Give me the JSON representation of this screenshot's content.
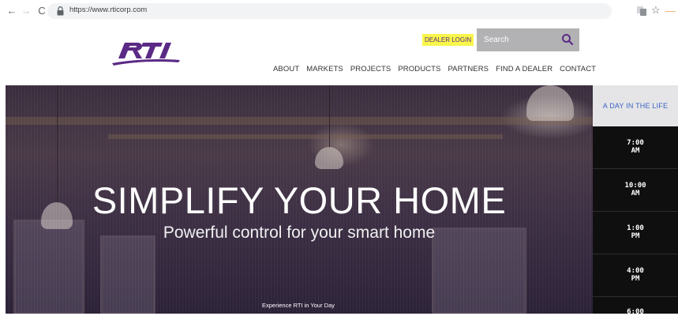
{
  "browser": {
    "url": "https://www.rticorp.com",
    "back_icon": "arrow-left",
    "forward_icon": "arrow-right",
    "reload_icon": "reload",
    "back_glyph": "←",
    "forward_glyph": "→",
    "reload_glyph": "C",
    "star_glyph": "☆",
    "menu_glyph": "—"
  },
  "header": {
    "logo_alt": "RTI",
    "dealer_login_label": "DEALER LOGIN",
    "dealer_login_highlight": "#f8f64a",
    "search_placeholder": "Search",
    "brand_color": "#5b2a86",
    "nav": [
      "ABOUT",
      "MARKETS",
      "PROJECTS",
      "PRODUCTS",
      "PARTNERS",
      "FIND A DEALER",
      "CONTACT"
    ]
  },
  "hero": {
    "title": "SIMPLIFY YOUR HOME",
    "subtitle": "Powerful control for your smart home",
    "cta": "Experience RTI in Your Day"
  },
  "day_panel": {
    "title": "A DAY IN THE LIFE",
    "title_color": "#3d63c3",
    "slots": [
      {
        "time": "7:00",
        "period": "AM"
      },
      {
        "time": "10:00",
        "period": "AM"
      },
      {
        "time": "1:00",
        "period": "PM"
      },
      {
        "time": "4:00",
        "period": "PM"
      },
      {
        "time": "6:00",
        "period": ""
      }
    ]
  }
}
